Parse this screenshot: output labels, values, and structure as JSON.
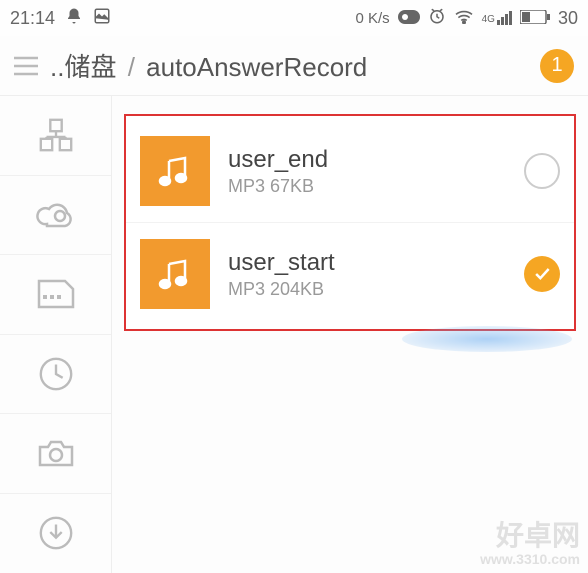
{
  "status": {
    "time": "21:14",
    "data_rate": "0 K/s",
    "signal_label": "4G",
    "battery": "30"
  },
  "path": {
    "crumb1": "..储盘",
    "sep": "/",
    "crumb2": "autoAnswerRecord",
    "count": "1"
  },
  "files": [
    {
      "name": "user_end",
      "meta": "MP3 67KB",
      "selected": false
    },
    {
      "name": "user_start",
      "meta": "MP3 204KB",
      "selected": true
    }
  ],
  "watermark": {
    "main": "好卓网",
    "sub": "www.3310.com"
  }
}
